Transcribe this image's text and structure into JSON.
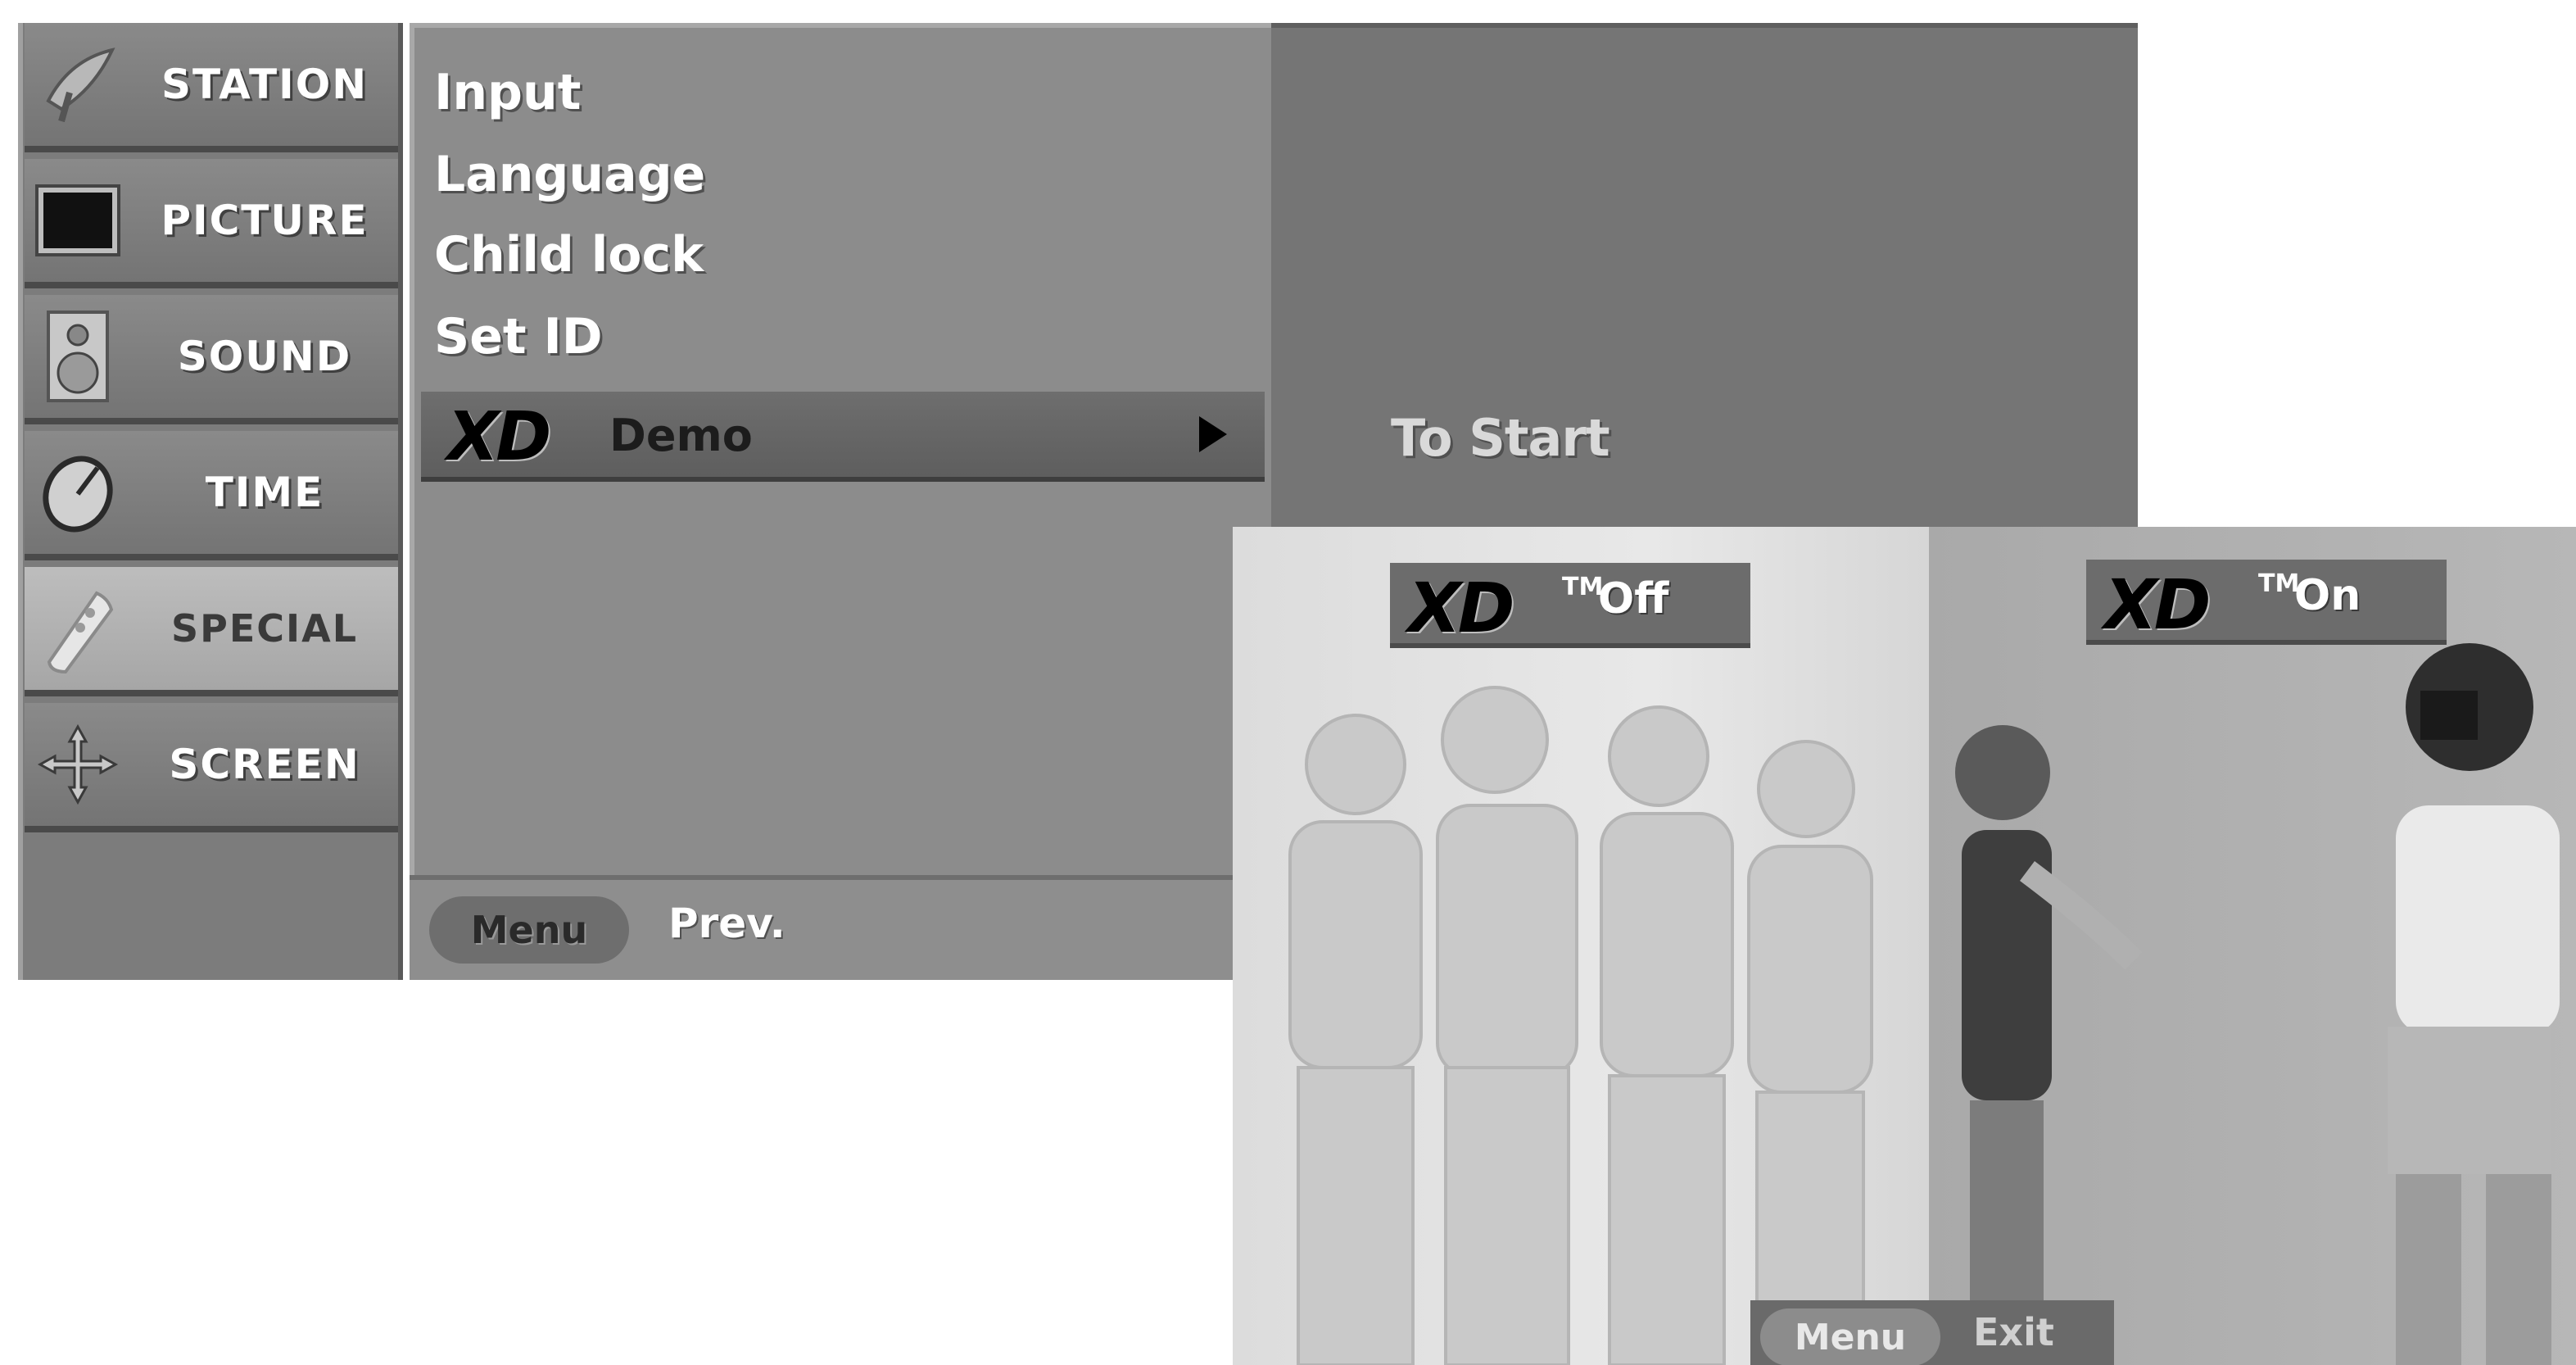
{
  "sidebar": {
    "items": [
      {
        "label": "STATION",
        "icon": "satellite-dish-icon",
        "active": false
      },
      {
        "label": "PICTURE",
        "icon": "tv-screen-icon",
        "active": false
      },
      {
        "label": "SOUND",
        "icon": "speaker-icon",
        "active": false
      },
      {
        "label": "TIME",
        "icon": "clock-icon",
        "active": false
      },
      {
        "label": "SPECIAL",
        "icon": "remote-control-icon",
        "active": true
      },
      {
        "label": "SCREEN",
        "icon": "move-arrows-icon",
        "active": false
      }
    ]
  },
  "submenu": {
    "items": [
      "Input",
      "Language",
      "Child lock",
      "Set ID"
    ],
    "selected": {
      "logo": "XD",
      "label": "Demo"
    }
  },
  "footer": {
    "menu_button": "Menu",
    "prev_label": "Prev."
  },
  "right_panel": {
    "hint": "To Start"
  },
  "demo": {
    "left_tag": {
      "logo": "XD",
      "tm": "TM",
      "state": "Off"
    },
    "right_tag": {
      "logo": "XD",
      "tm": "TM",
      "state": "On"
    },
    "footer": {
      "menu_button": "Menu",
      "exit_label": "Exit"
    }
  },
  "colors": {
    "menu_gray": "#8c8c8c",
    "panel_gray": "#757575",
    "highlight": "#bdbdbd"
  }
}
